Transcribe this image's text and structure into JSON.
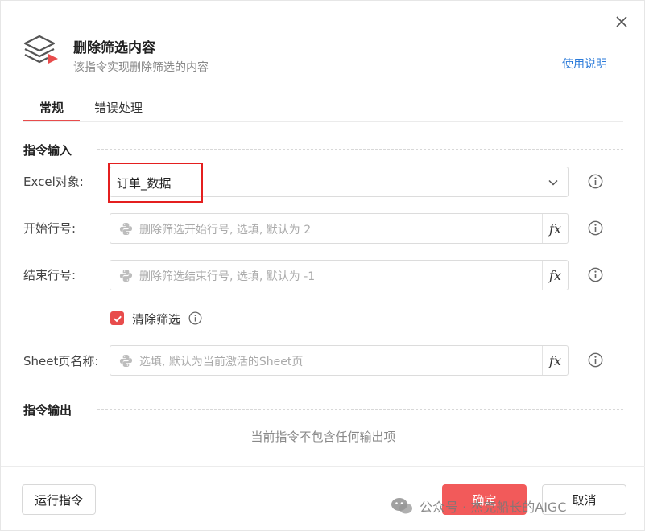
{
  "header": {
    "title": "删除筛选内容",
    "subtitle": "该指令实现删除筛选的内容",
    "help_link": "使用说明"
  },
  "tabs": [
    {
      "label": "常规",
      "active": true
    },
    {
      "label": "错误处理",
      "active": false
    }
  ],
  "input_section": {
    "title": "指令输入",
    "excel_object": {
      "label": "Excel对象:",
      "value": "订单_数据"
    },
    "start_row": {
      "label": "开始行号:",
      "placeholder": "删除筛选开始行号, 选填,  默认为 2"
    },
    "end_row": {
      "label": "结束行号:",
      "placeholder": "删除筛选结束行号, 选填,  默认为 -1"
    },
    "clear_filter": {
      "label": "清除筛选",
      "checked": true
    },
    "sheet_name": {
      "label": "Sheet页名称:",
      "placeholder": "选填, 默认为当前激活的Sheet页"
    },
    "fx_label": "fx"
  },
  "output_section": {
    "title": "指令输出",
    "empty_text": "当前指令不包含任何输出项"
  },
  "footer": {
    "run_label": "运行指令",
    "ok_label": "确定",
    "cancel_label": "取消"
  },
  "watermark": {
    "text": "公众号 · 杰克船长的AIGC"
  },
  "colors": {
    "accent": "#e84c4c",
    "link": "#2a7ad9",
    "highlight_box": "#e41f1f"
  }
}
